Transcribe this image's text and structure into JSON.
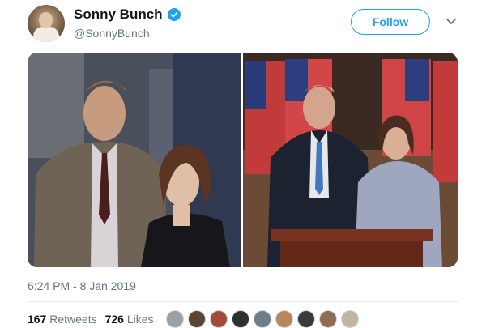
{
  "user": {
    "display_name": "Sonny Bunch",
    "handle": "@SonnyBunch",
    "verified": true
  },
  "actions": {
    "follow_label": "Follow"
  },
  "tweet": {
    "timestamp": "6:24 PM - 8 Jan 2019"
  },
  "stats": {
    "retweets_count": "167",
    "retweets_label": "Retweets",
    "likes_count": "726",
    "likes_label": "Likes"
  },
  "likers": [
    "#9aa0a6",
    "#5b4636",
    "#a24b3a",
    "#2f2f2f",
    "#6d7d8b",
    "#b8875d",
    "#3a3a3a",
    "#8f6b54",
    "#c2b4a3"
  ],
  "colors": {
    "accent": "#1da1f2",
    "text": "#14171a",
    "muted": "#657786"
  }
}
